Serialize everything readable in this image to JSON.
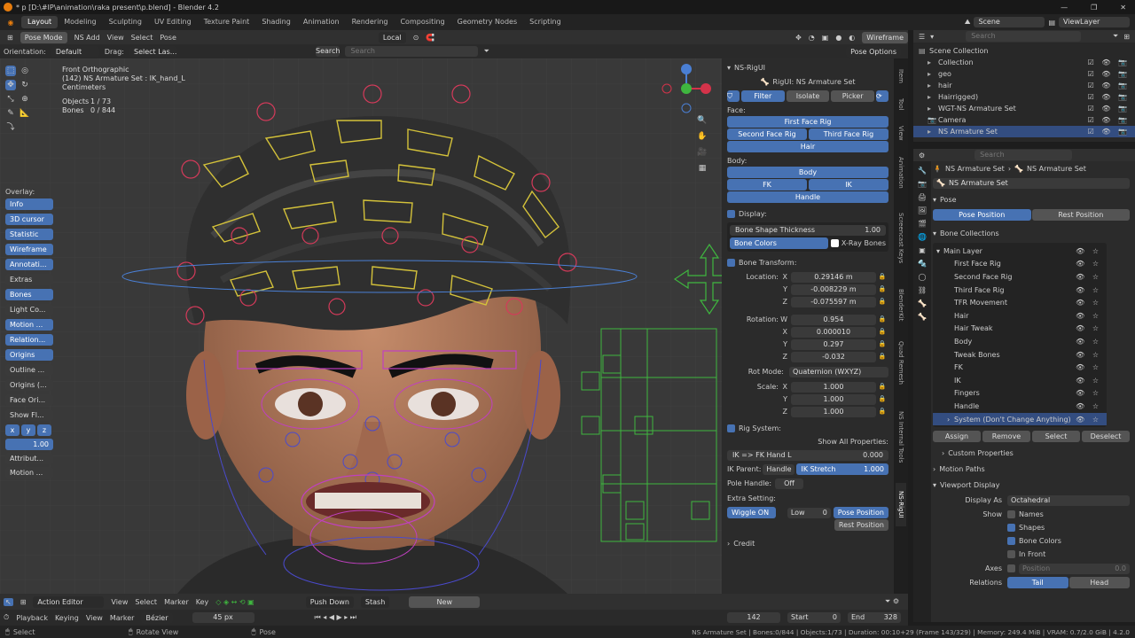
{
  "titlebar": {
    "title": "* p [D:\\#IP\\animation\\raka present\\p.blend] - Blender 4.2"
  },
  "workspace_tabs": [
    "Layout",
    "Modeling",
    "Sculpting",
    "UV Editing",
    "Texture Paint",
    "Shading",
    "Animation",
    "Rendering",
    "Compositing",
    "Geometry Nodes",
    "Scripting"
  ],
  "top_right": {
    "scene": "Scene",
    "viewlayer": "ViewLayer"
  },
  "viewport_header": {
    "mode": "Pose Mode",
    "menus": [
      "NS Add",
      "View",
      "Select",
      "Pose"
    ],
    "transform": "Local",
    "shading": "Wireframe",
    "search_placeholder": "Search",
    "pose_options": "Pose Options"
  },
  "viewport_subheader": {
    "orientation_label": "Orientation:",
    "orientation": "Default",
    "drag_label": "Drag:",
    "drag": "Select Las..."
  },
  "viewport_info": {
    "view": "Front Orthographic",
    "object": "(142) NS Armature Set : IK_hand_L",
    "units": "Centimeters",
    "objects_label": "Objects",
    "objects": "1 / 73",
    "bones_label": "Bones",
    "bones": "0 / 844"
  },
  "overlay": {
    "title": "Overlay:",
    "items": [
      "Info",
      "3D cursor",
      "Statistic",
      "Wireframe",
      "Annotati...",
      "Extras",
      "Bones",
      "Light Co...",
      "Motion ...",
      "Relation...",
      "Origins",
      "Outline ...",
      "Origins (...",
      "Face Ori...",
      "Show Fl..."
    ],
    "axes": [
      "x",
      "y",
      "z"
    ],
    "value": "1.00",
    "extra": [
      "Attribut...",
      "Motion ..."
    ]
  },
  "npanel": {
    "tabs": [
      "Item",
      "Tool",
      "View",
      "Animation",
      "Screencast Keys",
      "BlenderKit",
      "Quad Remesh",
      "NS Internal Tools",
      "NS-RigUI"
    ],
    "header": "NS-RigUI",
    "rig_title": "RigUI: NS Armature Set",
    "filter": "Filter",
    "isolate": "Isolate",
    "picker": "Picker",
    "face_label": "Face:",
    "first_face": "First Face Rig",
    "second_face": "Second Face Rig",
    "third_face": "Third Face Rig",
    "hair": "Hair",
    "body_label": "Body:",
    "body": "Body",
    "fk": "FK",
    "ik": "IK",
    "handle": "Handle",
    "display_label": "Display:",
    "bone_shape_label": "Bone Shape Thickness",
    "bone_shape_value": "1.00",
    "bone_colors": "Bone Colors",
    "xray": "X-Ray Bones",
    "bone_transform": "Bone Transform:",
    "location_label": "Location:",
    "loc": [
      "0.29146 m",
      "-0.008229 m",
      "-0.075597 m"
    ],
    "rotation_label": "Rotation:",
    "rot": [
      "0.954",
      "0.000010",
      "0.297",
      "-0.032"
    ],
    "rot_axes": [
      "W",
      "X",
      "Y",
      "Z"
    ],
    "loc_axes": [
      "X",
      "Y",
      "Z"
    ],
    "rot_mode_label": "Rot Mode:",
    "rot_mode": "Quaternion (WXYZ)",
    "scale_label": "Scale:",
    "scale": [
      "1.000",
      "1.000",
      "1.000"
    ],
    "rig_system": "Rig System:",
    "show_all": "Show All Properties:",
    "ikfk_label": "IK => FK Hand L",
    "ikfk_value": "0.000",
    "ik_parent_label": "IK Parent:",
    "ik_parent": "Handle",
    "ik_stretch_label": "IK Stretch",
    "ik_stretch": "1.000",
    "pole_label": "Pole Handle:",
    "pole": "Off",
    "extra_label": "Extra Setting:",
    "wiggle": "Wiggle ON",
    "low_label": "Low",
    "low_value": "0",
    "pose_pos": "Pose Position",
    "rest_pos": "Rest Position",
    "credit": "Credit"
  },
  "outliner": {
    "search_placeholder": "Search",
    "items": [
      {
        "name": "Scene Collection",
        "indent": 0
      },
      {
        "name": "Collection",
        "indent": 1
      },
      {
        "name": "geo",
        "indent": 1
      },
      {
        "name": "hair",
        "indent": 1
      },
      {
        "name": "Hairrigged)",
        "indent": 1
      },
      {
        "name": "WGT-NS Armature Set",
        "indent": 1
      },
      {
        "name": "Camera",
        "indent": 1
      },
      {
        "name": "NS Armature Set",
        "indent": 1
      }
    ]
  },
  "properties": {
    "search_placeholder": "Search",
    "breadcrumb1": "NS Armature Set",
    "breadcrumb2": "NS Armature Set",
    "datablock": "NS Armature Set",
    "pose": "Pose",
    "pose_position": "Pose Position",
    "rest_position": "Rest Position",
    "bone_collections": "Bone Collections",
    "collections": [
      "Main Layer",
      "First Face Rig",
      "Second Face Rig",
      "Third Face Rig",
      "TFR Movement",
      "Hair",
      "Hair Tweak",
      "Body",
      "Tweak Bones",
      "FK",
      "IK",
      "Fingers",
      "Handle",
      "System (Don't Change Anything)"
    ],
    "assign": "Assign",
    "remove": "Remove",
    "select": "Select",
    "deselect": "Deselect",
    "custom_props": "Custom Properties",
    "motion_paths": "Motion Paths",
    "viewport_display": "Viewport Display",
    "display_as_label": "Display As",
    "display_as": "Octahedral",
    "show_label": "Show",
    "names": "Names",
    "shapes": "Shapes",
    "bone_colors": "Bone Colors",
    "in_front": "In Front",
    "axes_label": "Axes",
    "position": "Position",
    "position_value": "0.0",
    "relations_label": "Relations",
    "tail": "Tail",
    "head": "Head"
  },
  "timeline": {
    "editor": "Action Editor",
    "menus1": [
      "View",
      "Select",
      "Marker",
      "Key"
    ],
    "push_down": "Push Down",
    "stash": "Stash",
    "new": "New",
    "menus2": [
      "Playback",
      "Keying",
      "View",
      "Marker"
    ],
    "interp": "Bézier",
    "px": "45 px",
    "frame": "142",
    "start_label": "Start",
    "start": "0",
    "end_label": "End",
    "end": "328"
  },
  "statusbar": {
    "left": [
      "Select",
      "Rotate View",
      "Pose"
    ],
    "right": "NS Armature Set | Bones:0/844 | Objects:1/73 | Duration: 00:10+29 (Frame 143/329) | Memory: 249.4 MiB | VRAM: 0.7/2.0 GiB | 4.2.0"
  },
  "colors": {
    "accent": "#4772b3",
    "header": "#303030",
    "panel": "#2b2b2b"
  }
}
